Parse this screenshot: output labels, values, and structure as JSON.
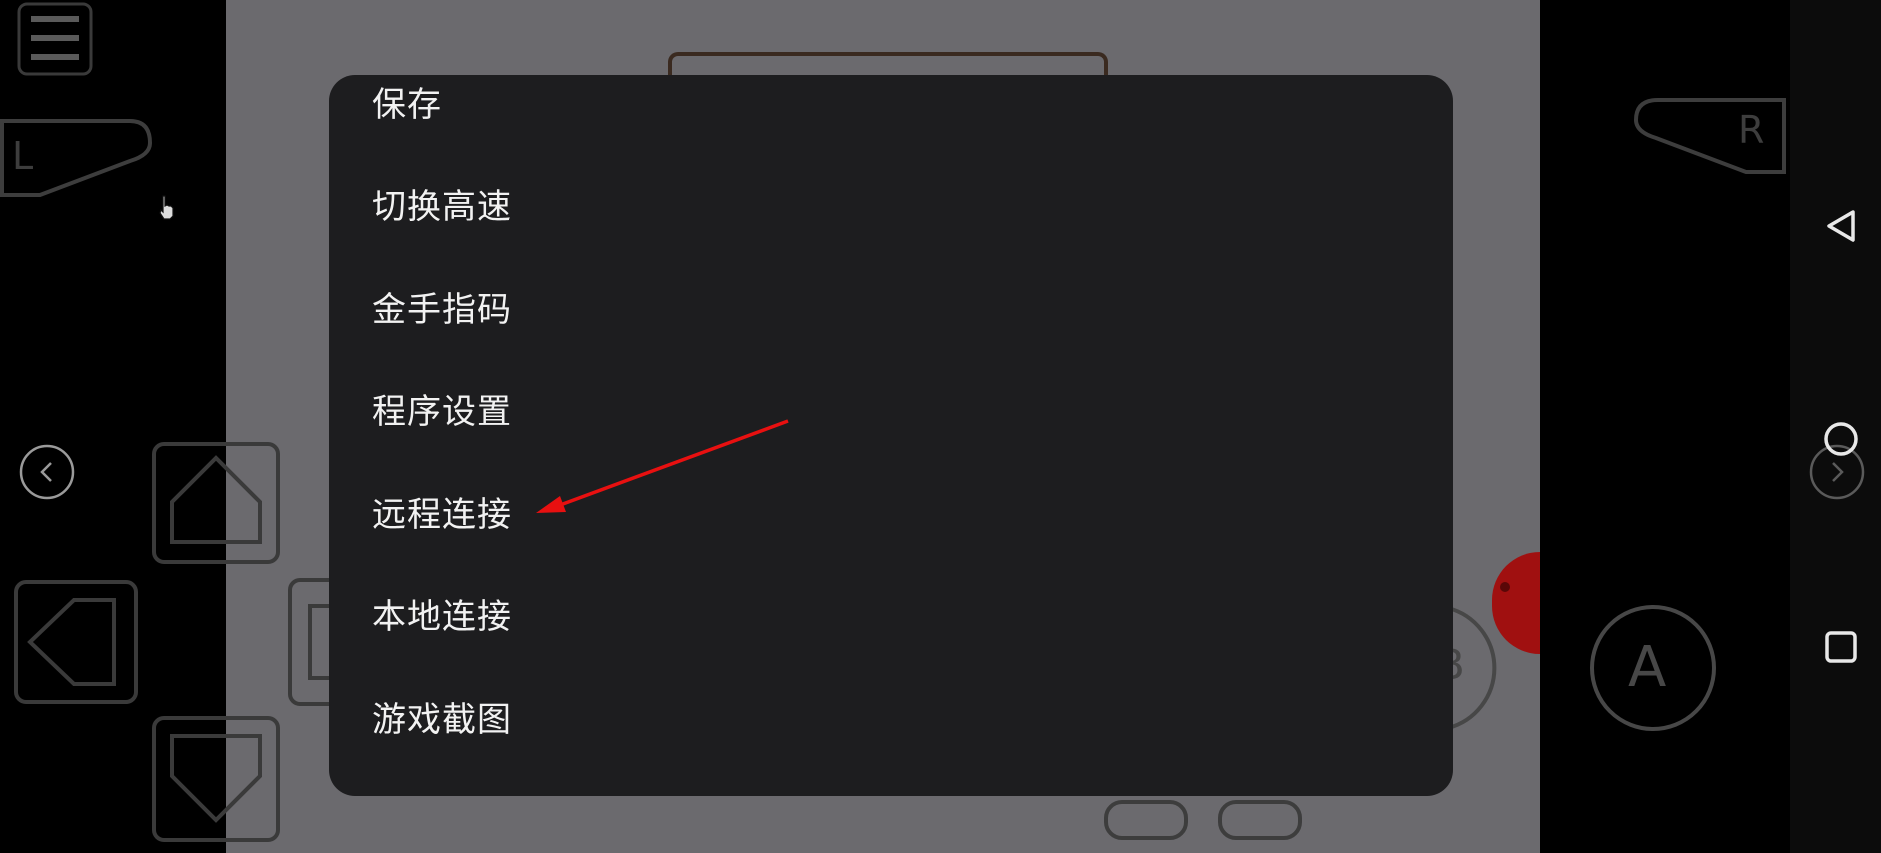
{
  "menu": {
    "items": [
      {
        "label": "保存"
      },
      {
        "label": "切换高速"
      },
      {
        "label": "金手指码"
      },
      {
        "label": "程序设置"
      },
      {
        "label": "远程连接"
      },
      {
        "label": "本地连接"
      },
      {
        "label": "游戏截图"
      }
    ]
  },
  "controls": {
    "l_label": "L",
    "r_label": "R",
    "a_label": "A",
    "b_label": "B"
  },
  "icons": {
    "menu": "hamburger-icon",
    "back": "triangle-back-icon",
    "home": "circle-home-icon",
    "recents": "square-recents-icon",
    "prev": "chevron-left-icon",
    "next": "chevron-right-icon",
    "pointer": "hand-cursor-icon"
  },
  "colors": {
    "menu_bg": "#1d1d1f",
    "menu_text": "#f2f2f2",
    "annotation_arrow": "#e81010",
    "dimmed_game": "#6b6a6e"
  }
}
